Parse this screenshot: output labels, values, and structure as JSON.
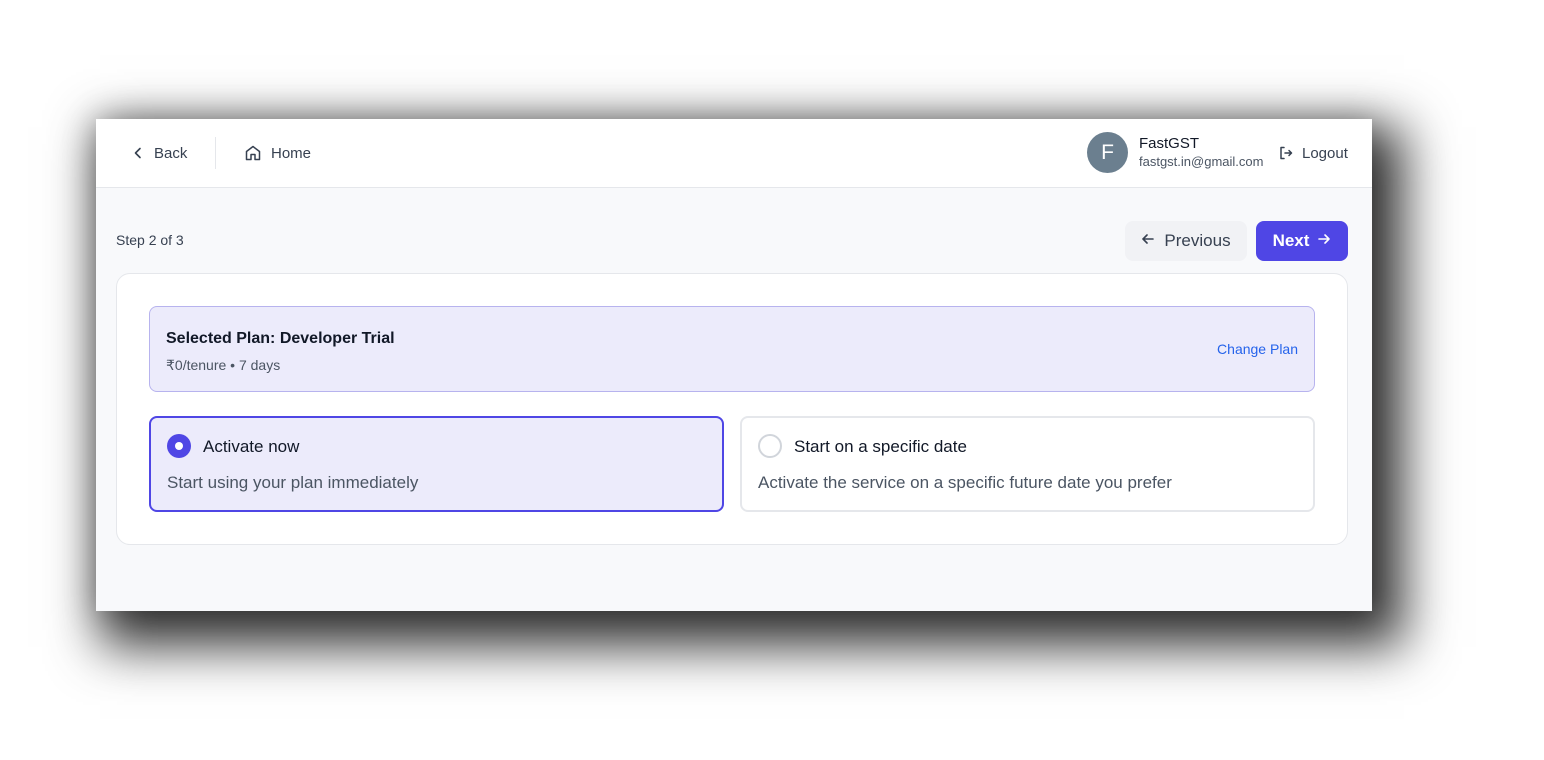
{
  "header": {
    "back_label": "Back",
    "home_label": "Home",
    "user": {
      "initial": "F",
      "name": "FastGST",
      "email": "fastgst.in@gmail.com"
    },
    "logout_label": "Logout"
  },
  "stepper": {
    "step_text": "Step 2 of 3",
    "previous_label": "Previous",
    "next_label": "Next"
  },
  "plan": {
    "title": "Selected Plan: Developer Trial",
    "subtitle": "₹0/tenure • 7 days",
    "change_label": "Change Plan"
  },
  "activation_options": [
    {
      "title": "Activate now",
      "description": "Start using your plan immediately",
      "selected": true
    },
    {
      "title": "Start on a specific date",
      "description": "Activate the service on a specific future date you prefer",
      "selected": false
    }
  ],
  "colors": {
    "accent": "#4f46e5",
    "accent_light": "#ecebfb",
    "link": "#2563eb",
    "avatar": "#6b7f8f"
  },
  "icons": [
    "chevron-left-icon",
    "home-icon",
    "logout-icon",
    "arrow-left-icon",
    "arrow-right-icon"
  ]
}
